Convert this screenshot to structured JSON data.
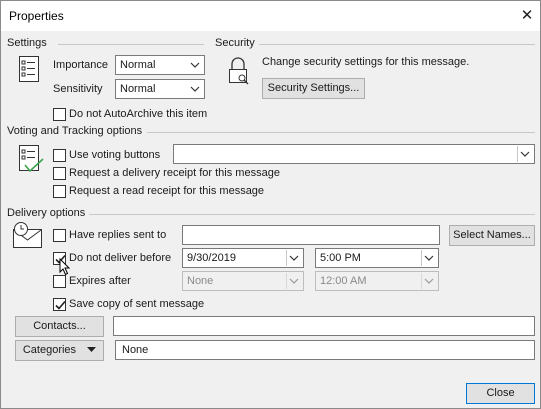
{
  "window": {
    "title": "Properties"
  },
  "settings": {
    "heading": "Settings",
    "importance_label": "Importance",
    "importance_value": "Normal",
    "sensitivity_label": "Sensitivity",
    "sensitivity_value": "Normal",
    "autoarchive_label": "Do not AutoArchive this item",
    "autoarchive_checked": false
  },
  "security": {
    "heading": "Security",
    "description": "Change security settings for this message.",
    "button_label": "Security Settings..."
  },
  "voting": {
    "heading": "Voting and Tracking options",
    "use_voting_label": "Use voting buttons",
    "voting_value": "",
    "delivery_receipt_label": "Request a delivery receipt for this message",
    "read_receipt_label": "Request a read receipt for this message"
  },
  "delivery": {
    "heading": "Delivery options",
    "replies_label": "Have replies sent to",
    "replies_value": "",
    "select_names_label": "Select Names...",
    "deliver_before_label": "Do not deliver before",
    "deliver_before_checked": true,
    "deliver_date": "9/30/2019",
    "deliver_time": "5:00 PM",
    "expires_label": "Expires after",
    "expires_checked": false,
    "expires_date": "None",
    "expires_time": "12:00 AM",
    "save_copy_label": "Save copy of sent message",
    "save_copy_checked": true
  },
  "contacts": {
    "button_label": "Contacts...",
    "value": ""
  },
  "categories": {
    "button_label": "Categories",
    "value": "None"
  },
  "footer": {
    "close_label": "Close"
  },
  "colors": {
    "accent": "#0078d7",
    "background": "#f0f0f0",
    "checkmark": "#1e1e1e"
  }
}
